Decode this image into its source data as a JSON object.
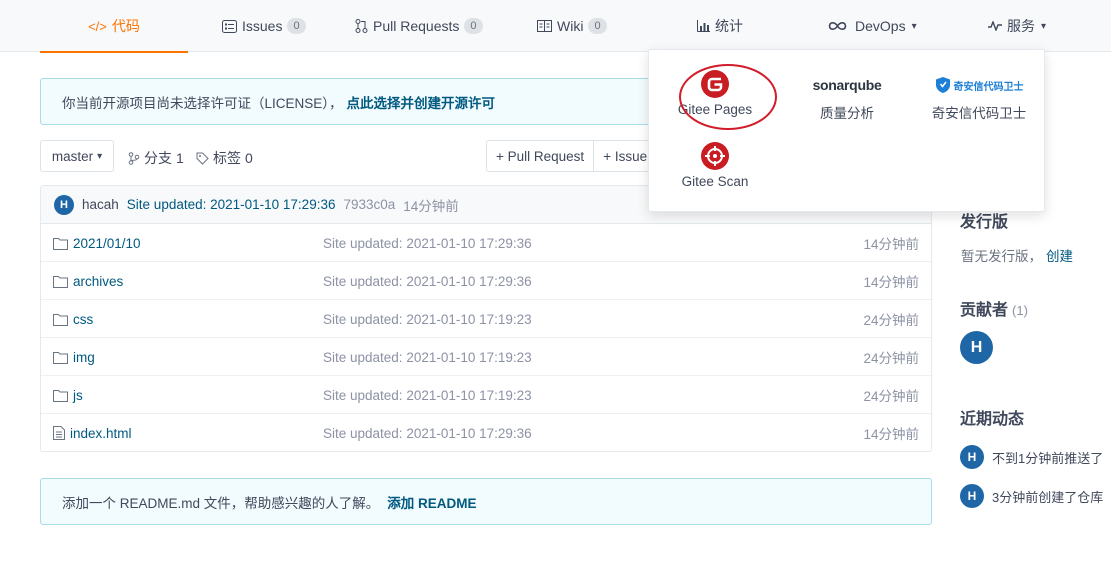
{
  "topnav": {
    "tabs": [
      {
        "label": "代码",
        "icon": "code-icon",
        "active": true
      },
      {
        "label": "Issues",
        "icon": "issues-icon",
        "badge": "0"
      },
      {
        "label": "Pull Requests",
        "icon": "pull-request-icon",
        "badge": "0"
      },
      {
        "label": "Wiki",
        "icon": "wiki-icon",
        "badge": "0"
      },
      {
        "label": "统计",
        "icon": "stats-icon"
      },
      {
        "label": "DevOps",
        "icon": "devops-icon"
      },
      {
        "label": "服务",
        "icon": "service-icon"
      }
    ]
  },
  "license_notice": {
    "text": "你当前开源项目尚未选择许可证（LICENSE），",
    "link": "点此选择并创建开源许可"
  },
  "toolbar": {
    "branch": "master",
    "branches_label": "分支",
    "branches_count": "1",
    "tags_label": "标签",
    "tags_count": "0",
    "pull_request_button": "+ Pull Request",
    "issue_button": "+ Issue"
  },
  "latest_commit": {
    "avatar": "H",
    "user": "hacah",
    "message": "Site updated: 2021-01-10 17:29:36",
    "sha": "7933c0a",
    "time": "14分钟前"
  },
  "files": [
    {
      "name": "2021/01/10",
      "type": "folder",
      "message": "Site updated: 2021-01-10 17:29:36",
      "time": "14分钟前"
    },
    {
      "name": "archives",
      "type": "folder",
      "message": "Site updated: 2021-01-10 17:29:36",
      "time": "14分钟前"
    },
    {
      "name": "css",
      "type": "folder",
      "message": "Site updated: 2021-01-10 17:19:23",
      "time": "24分钟前"
    },
    {
      "name": "img",
      "type": "folder",
      "message": "Site updated: 2021-01-10 17:19:23",
      "time": "24分钟前"
    },
    {
      "name": "js",
      "type": "folder",
      "message": "Site updated: 2021-01-10 17:19:23",
      "time": "24分钟前"
    },
    {
      "name": "index.html",
      "type": "file",
      "message": "Site updated: 2021-01-10 17:29:36",
      "time": "14分钟前"
    }
  ],
  "readme_notice": {
    "text": "添加一个 README.md 文件，帮助感兴趣的人了解。",
    "link": "添加 README"
  },
  "sidebar": {
    "release_title": "发行版",
    "release_empty": "暂无发行版，",
    "release_create": "创建",
    "contributors_title": "贡献者",
    "contributors_count": "(1)",
    "contributor_avatar": "H",
    "activity_title": "近期动态",
    "activities": [
      {
        "avatar": "H",
        "text": "不到1分钟前推送了"
      },
      {
        "avatar": "H",
        "text": "3分钟前创建了仓库"
      }
    ]
  },
  "services_dropdown": {
    "items": [
      {
        "label": "Gitee Pages",
        "icon": "gitee-pages-icon",
        "color": "#c71d23"
      },
      {
        "label": "质量分析",
        "icon": "sonarqube-icon",
        "logo_text": "sonarqube"
      },
      {
        "label": "奇安信代码卫士",
        "icon": "qianxin-icon",
        "logo_text": "奇安信代码卫士"
      },
      {
        "label": "Gitee Scan",
        "icon": "gitee-scan-icon",
        "color": "#c71d23"
      }
    ]
  },
  "colors": {
    "accent": "#fe7300",
    "link": "#005980",
    "avatar": "#1f66a7",
    "gitee_red": "#c71d23"
  }
}
